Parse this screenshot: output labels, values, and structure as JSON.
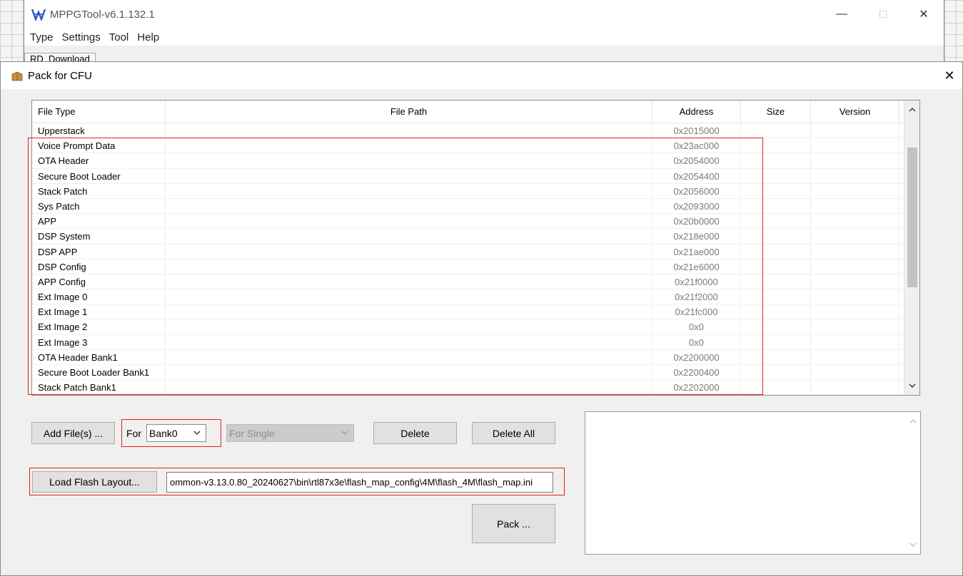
{
  "parent_window": {
    "title": "MPPGTool-v6.1.132.1",
    "menu": [
      "Type",
      "Settings",
      "Tool",
      "Help"
    ],
    "tab_label": "RD_Download",
    "controls": {
      "minimize": "—",
      "maximize": "☐",
      "close": "✕"
    }
  },
  "dialog": {
    "title": "Pack for CFU",
    "close": "✕"
  },
  "table": {
    "columns": {
      "file_type": "File Type",
      "file_path": "File Path",
      "address": "Address",
      "size": "Size",
      "version": "Version"
    },
    "rows": [
      {
        "file_type": "Upperstack",
        "address": "0x2015000"
      },
      {
        "file_type": "Voice Prompt Data",
        "address": "0x23ac000"
      },
      {
        "file_type": "OTA Header",
        "address": "0x2054000"
      },
      {
        "file_type": "Secure Boot Loader",
        "address": "0x2054400"
      },
      {
        "file_type": "Stack Patch",
        "address": "0x2056000"
      },
      {
        "file_type": "Sys Patch",
        "address": "0x2093000"
      },
      {
        "file_type": "APP",
        "address": "0x20b0000"
      },
      {
        "file_type": "DSP System",
        "address": "0x218e000"
      },
      {
        "file_type": "DSP APP",
        "address": "0x21ae000"
      },
      {
        "file_type": "DSP Config",
        "address": "0x21e6000"
      },
      {
        "file_type": "APP Config",
        "address": "0x21f0000"
      },
      {
        "file_type": "Ext Image 0",
        "address": "0x21f2000"
      },
      {
        "file_type": "Ext Image 1",
        "address": "0x21fc000"
      },
      {
        "file_type": "Ext Image 2",
        "address": "0x0"
      },
      {
        "file_type": "Ext Image 3",
        "address": "0x0"
      },
      {
        "file_type": "OTA Header Bank1",
        "address": "0x2200000"
      },
      {
        "file_type": "Secure Boot Loader Bank1",
        "address": "0x2200400"
      },
      {
        "file_type": "Stack Patch Bank1",
        "address": "0x2202000"
      }
    ]
  },
  "controls": {
    "add_files": "Add File(s) ...",
    "for_label": "For",
    "bank_select": "Bank0",
    "mode_select": "For Single",
    "delete": "Delete",
    "delete_all": "Delete All",
    "load_flash_layout": "Load Flash Layout...",
    "flash_layout_path": "ommon-v3.13.0.80_20240627\\bin\\rtl87x3e\\flash_map_config\\4M\\flash_4M\\flash_map.ini",
    "pack": "Pack ..."
  },
  "colors": {
    "highlight": "#e02020",
    "dialog_bg": "#f0f0f0",
    "address_text": "#7a7a7a"
  }
}
